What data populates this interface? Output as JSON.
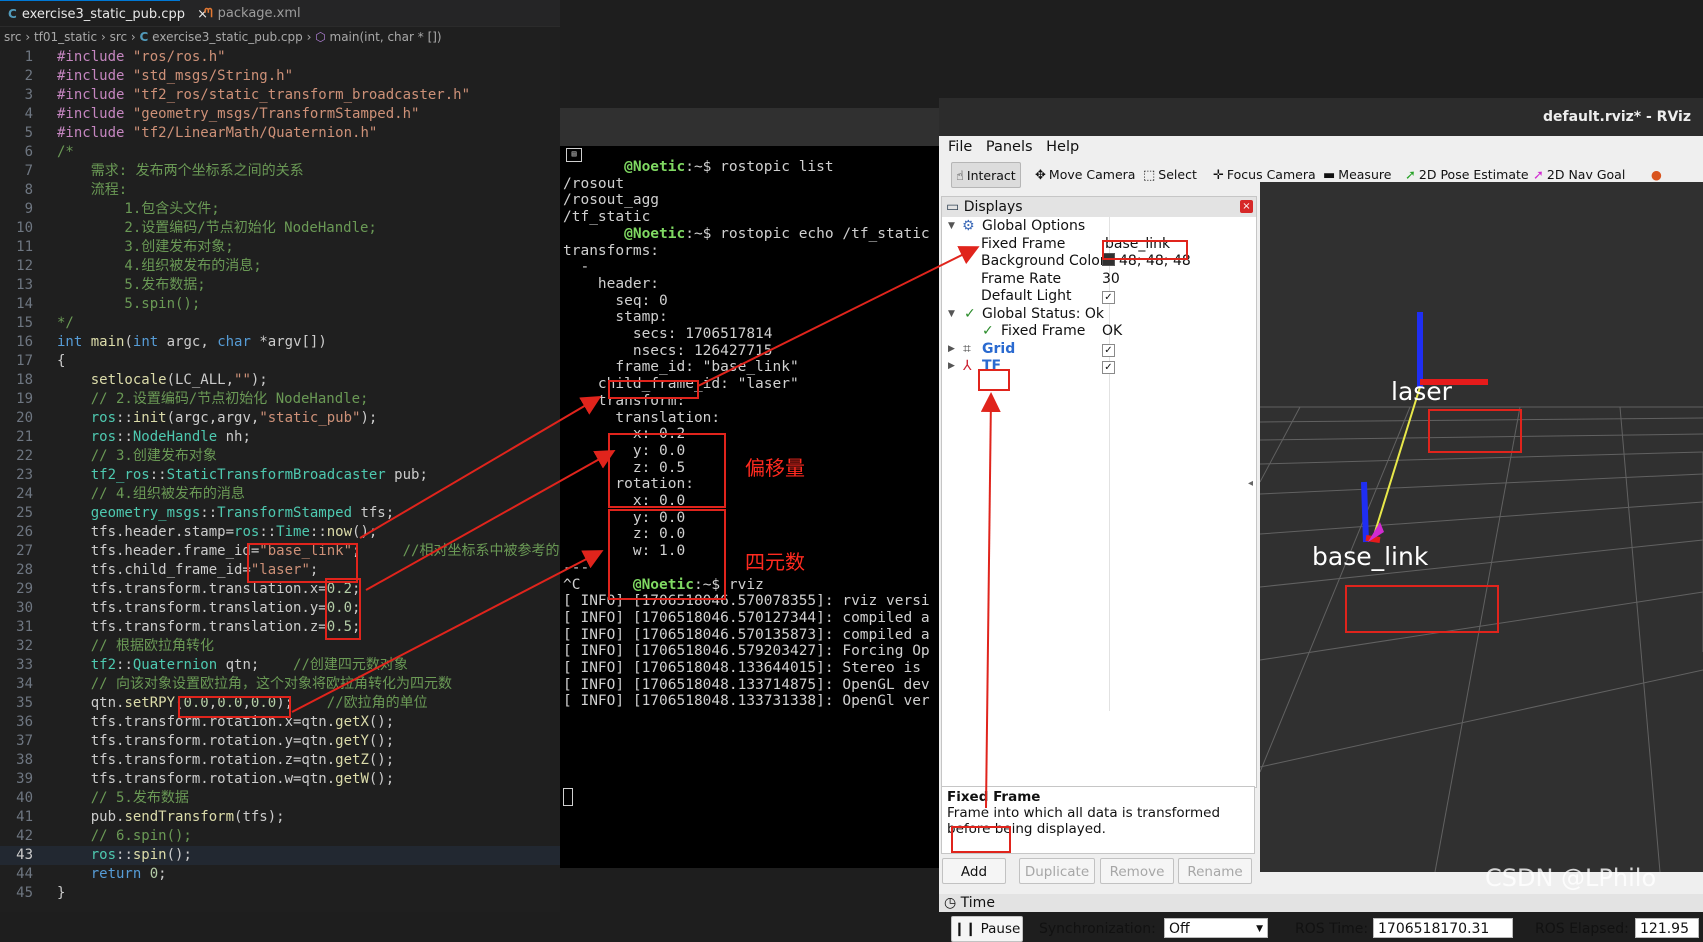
{
  "editor": {
    "tabs": [
      {
        "icon": "C",
        "label": "exercise3_static_pub.cpp",
        "close": "×"
      },
      {
        "icon": "ᘉ",
        "label": "package.xml"
      }
    ],
    "breadcrumb": [
      "src",
      "tf01_static",
      "src",
      "exercise3_static_pub.cpp",
      "main(int, char * [])"
    ],
    "current_line": 43,
    "lines": [
      {
        "n": "1",
        "html": "<span class='pp'>#include</span> <span class='str'>\"ros/ros.h\"</span>"
      },
      {
        "n": "2",
        "html": "<span class='pp'>#include</span> <span class='str'>\"std_msgs/String.h\"</span>"
      },
      {
        "n": "3",
        "html": "<span class='pp'>#include</span> <span class='str'>\"tf2_ros/static_transform_broadcaster.h\"</span>"
      },
      {
        "n": "4",
        "html": "<span class='pp'>#include</span> <span class='str'>\"geometry_msgs/TransformStamped.h\"</span>"
      },
      {
        "n": "5",
        "html": "<span class='pp'>#include</span> <span class='str'>\"tf2/LinearMath/Quaternion.h\"</span>"
      },
      {
        "n": "6",
        "html": "<span class='cm'>/*</span>"
      },
      {
        "n": "7",
        "html": "<span class='cm'>    需求: 发布两个坐标系之间的关系</span>"
      },
      {
        "n": "8",
        "html": "<span class='cm'>    流程:</span>"
      },
      {
        "n": "9",
        "html": "<span class='cm'>        1.包含头文件;</span>"
      },
      {
        "n": "10",
        "html": "<span class='cm'>        2.设置编码/节点初始化 NodeHandle;</span>"
      },
      {
        "n": "11",
        "html": "<span class='cm'>        3.创建发布对象;</span>"
      },
      {
        "n": "12",
        "html": "<span class='cm'>        4.组织被发布的消息;</span>"
      },
      {
        "n": "13",
        "html": "<span class='cm'>        5.发布数据;</span>"
      },
      {
        "n": "14",
        "html": "<span class='cm'>        5.spin();</span>"
      },
      {
        "n": "15",
        "html": "<span class='cm'>*/</span>"
      },
      {
        "n": "16",
        "html": "<span class='kw'>int</span> <span class='fn'>main</span>(<span class='kw'>int</span> argc, <span class='kw'>char</span> *argv[])"
      },
      {
        "n": "17",
        "html": "{"
      },
      {
        "n": "18",
        "html": "    <span class='fn'>setlocale</span>(LC_ALL,<span class='str'>\"\"</span>);"
      },
      {
        "n": "19",
        "html": "    <span class='cm'>// 2.设置编码/节点初始化 NodeHandle;</span>"
      },
      {
        "n": "20",
        "html": "    <span class='ty'>ros</span>::<span class='fn'>init</span>(argc,argv,<span class='str'>\"static_pub\"</span>);"
      },
      {
        "n": "21",
        "html": "    <span class='ty'>ros</span>::<span class='ty'>NodeHandle</span> nh;"
      },
      {
        "n": "22",
        "html": "    <span class='cm'>// 3.创建发布对象</span>"
      },
      {
        "n": "23",
        "html": "    <span class='ty'>tf2_ros</span>::<span class='ty'>StaticTransformBroadcaster</span> pub;"
      },
      {
        "n": "24",
        "html": "    <span class='cm'>// 4.组织被发布的消息</span>"
      },
      {
        "n": "25",
        "html": "    <span class='ty'>geometry_msgs</span>::<span class='ty'>TransformStamped</span> tfs;"
      },
      {
        "n": "26",
        "html": "    tfs.header.stamp=<span class='ty'>ros</span>::<span class='ty'>Time</span>::<span class='fn'>now</span>();"
      },
      {
        "n": "27",
        "html": "    tfs.header.frame_id=<span class='str'>\"base_link\"</span>;     <span class='cm'>//相对坐标系中被参考的</span>"
      },
      {
        "n": "28",
        "html": "    tfs.child_frame_id=<span class='str'>\"laser\"</span>;"
      },
      {
        "n": "29",
        "html": "    tfs.transform.translation.x=<span class='nm'>0.2</span>;"
      },
      {
        "n": "30",
        "html": "    tfs.transform.translation.y=<span class='nm'>0.0</span>;"
      },
      {
        "n": "31",
        "html": "    tfs.transform.translation.z=<span class='nm'>0.5</span>;"
      },
      {
        "n": "32",
        "html": "    <span class='cm'>// 根据欧拉角转化</span>"
      },
      {
        "n": "33",
        "html": "    <span class='ty'>tf2</span>::<span class='ty'>Quaternion</span> qtn;    <span class='cm'>//创建四元数对象</span>"
      },
      {
        "n": "34",
        "html": "    <span class='cm'>// 向该对象设置欧拉角，这个对象将欧拉角转化为四元数</span>"
      },
      {
        "n": "35",
        "html": "    qtn.<span class='fn'>setRPY</span>(<span class='nm'>0.0</span>,<span class='nm'>0.0</span>,<span class='nm'>0.0</span>);    <span class='cm'>//欧拉角的单位</span>"
      },
      {
        "n": "36",
        "html": "    tfs.transform.rotation.x=qtn.<span class='fn'>getX</span>();"
      },
      {
        "n": "37",
        "html": "    tfs.transform.rotation.y=qtn.<span class='fn'>getY</span>();"
      },
      {
        "n": "38",
        "html": "    tfs.transform.rotation.z=qtn.<span class='fn'>getZ</span>();"
      },
      {
        "n": "39",
        "html": "    tfs.transform.rotation.w=qtn.<span class='fn'>getW</span>();"
      },
      {
        "n": "40",
        "html": "    <span class='cm'>// 5.发布数据</span>"
      },
      {
        "n": "41",
        "html": "    pub.<span class='fn'>sendTransform</span>(tfs);"
      },
      {
        "n": "42",
        "html": "    <span class='cm'>// 6.spin();</span>"
      },
      {
        "n": "43",
        "html": "    <span class='ty'>ros</span>::<span class='fn'>spin</span>();"
      },
      {
        "n": "44",
        "html": "    <span class='kw'>return</span> <span class='nm'>0</span>;"
      },
      {
        "n": "45",
        "html": "}"
      }
    ]
  },
  "terminal": {
    "lines": [
      {
        "user": "@Noetic",
        "text": ":~$ rostopic list"
      },
      {
        "text": "/rosout"
      },
      {
        "text": "/rosout_agg"
      },
      {
        "text": "/tf_static"
      },
      {
        "user": "@Noetic",
        "text": ":~$ rostopic echo /tf_static"
      },
      {
        "text": "transforms:"
      },
      {
        "text": "  -"
      },
      {
        "text": "    header:"
      },
      {
        "text": "      seq: 0"
      },
      {
        "text": "      stamp:"
      },
      {
        "text": "        secs: 1706517814"
      },
      {
        "text": "        nsecs: 126427715"
      },
      {
        "text": "      frame_id: \"base_link\""
      },
      {
        "text": "    child_frame_id: \"laser\""
      },
      {
        "text": "    transform:"
      },
      {
        "text": "      translation:"
      },
      {
        "text": "        x: 0.2"
      },
      {
        "text": "        y: 0.0"
      },
      {
        "text": "        z: 0.5"
      },
      {
        "text": "      rotation:"
      },
      {
        "text": "        x: 0.0"
      },
      {
        "text": "        y: 0.0"
      },
      {
        "text": "        z: 0.0"
      },
      {
        "text": "        w: 1.0"
      },
      {
        "text": "---"
      },
      {
        "pre": "^C",
        "user": "@Noetic",
        "text": ":~$ rviz"
      },
      {
        "text": "[ INFO] [1706518046.570078355]: rviz versi"
      },
      {
        "text": "[ INFO] [1706518046.570127344]: compiled a"
      },
      {
        "text": "[ INFO] [1706518046.570135873]: compiled a"
      },
      {
        "text": "[ INFO] [1706518046.579203427]: Forcing Op"
      },
      {
        "text": "[ INFO] [1706518048.133644015]: Stereo is"
      },
      {
        "text": "[ INFO] [1706518048.133714875]: OpenGL dev"
      },
      {
        "text": "[ INFO] [1706518048.133731338]: OpenGl ver"
      }
    ]
  },
  "rviz": {
    "title": "default.rviz* - RViz",
    "menu": [
      "File",
      "Panels",
      "Help"
    ],
    "tools": [
      {
        "icon": "☝",
        "label": "Interact",
        "active": true
      },
      {
        "icon": "✥",
        "label": "Move Camera"
      },
      {
        "icon": "⬚",
        "label": "Select"
      },
      {
        "icon": "✛",
        "label": "Focus Camera"
      },
      {
        "icon": "▬",
        "label": "Measure"
      },
      {
        "icon": "➚",
        "label": "2D Pose Estimate"
      },
      {
        "icon": "➚",
        "label": "2D Nav Goal"
      }
    ],
    "displays": {
      "title": "Displays",
      "global_options": "Global Options",
      "fixed_frame_label": "Fixed Frame",
      "fixed_frame_value": "base_link",
      "background_color_label": "Background Color",
      "background_color_value": "48; 48; 48",
      "background_color_hex": "#303030",
      "frame_rate_label": "Frame Rate",
      "frame_rate_value": "30",
      "default_light_label": "Default Light",
      "global_status": "Global Status: Ok",
      "fixed_frame_status_label": "Fixed Frame",
      "fixed_frame_status_value": "OK",
      "grid": "Grid",
      "tf": "TF"
    },
    "help": {
      "title": "Fixed Frame",
      "text": "Frame into which all data is transformed before being displayed."
    },
    "buttons": {
      "add": "Add",
      "duplicate": "Duplicate",
      "remove": "Remove",
      "rename": "Rename"
    },
    "time": {
      "title": "Time",
      "pause": "Pause",
      "sync_label": "Synchronization:",
      "sync_value": "Off",
      "ros_time_label": "ROS Time:",
      "ros_time_value": "1706518170.31",
      "ros_elapsed_label": "ROS Elapsed:",
      "ros_elapsed_value": "121.95"
    },
    "scene": {
      "laser": "laser",
      "base_link": "base_link"
    }
  },
  "annotations": {
    "offset": "偏移量",
    "quaternion": "四元数",
    "watermark": "CSDN @LPhilo"
  }
}
